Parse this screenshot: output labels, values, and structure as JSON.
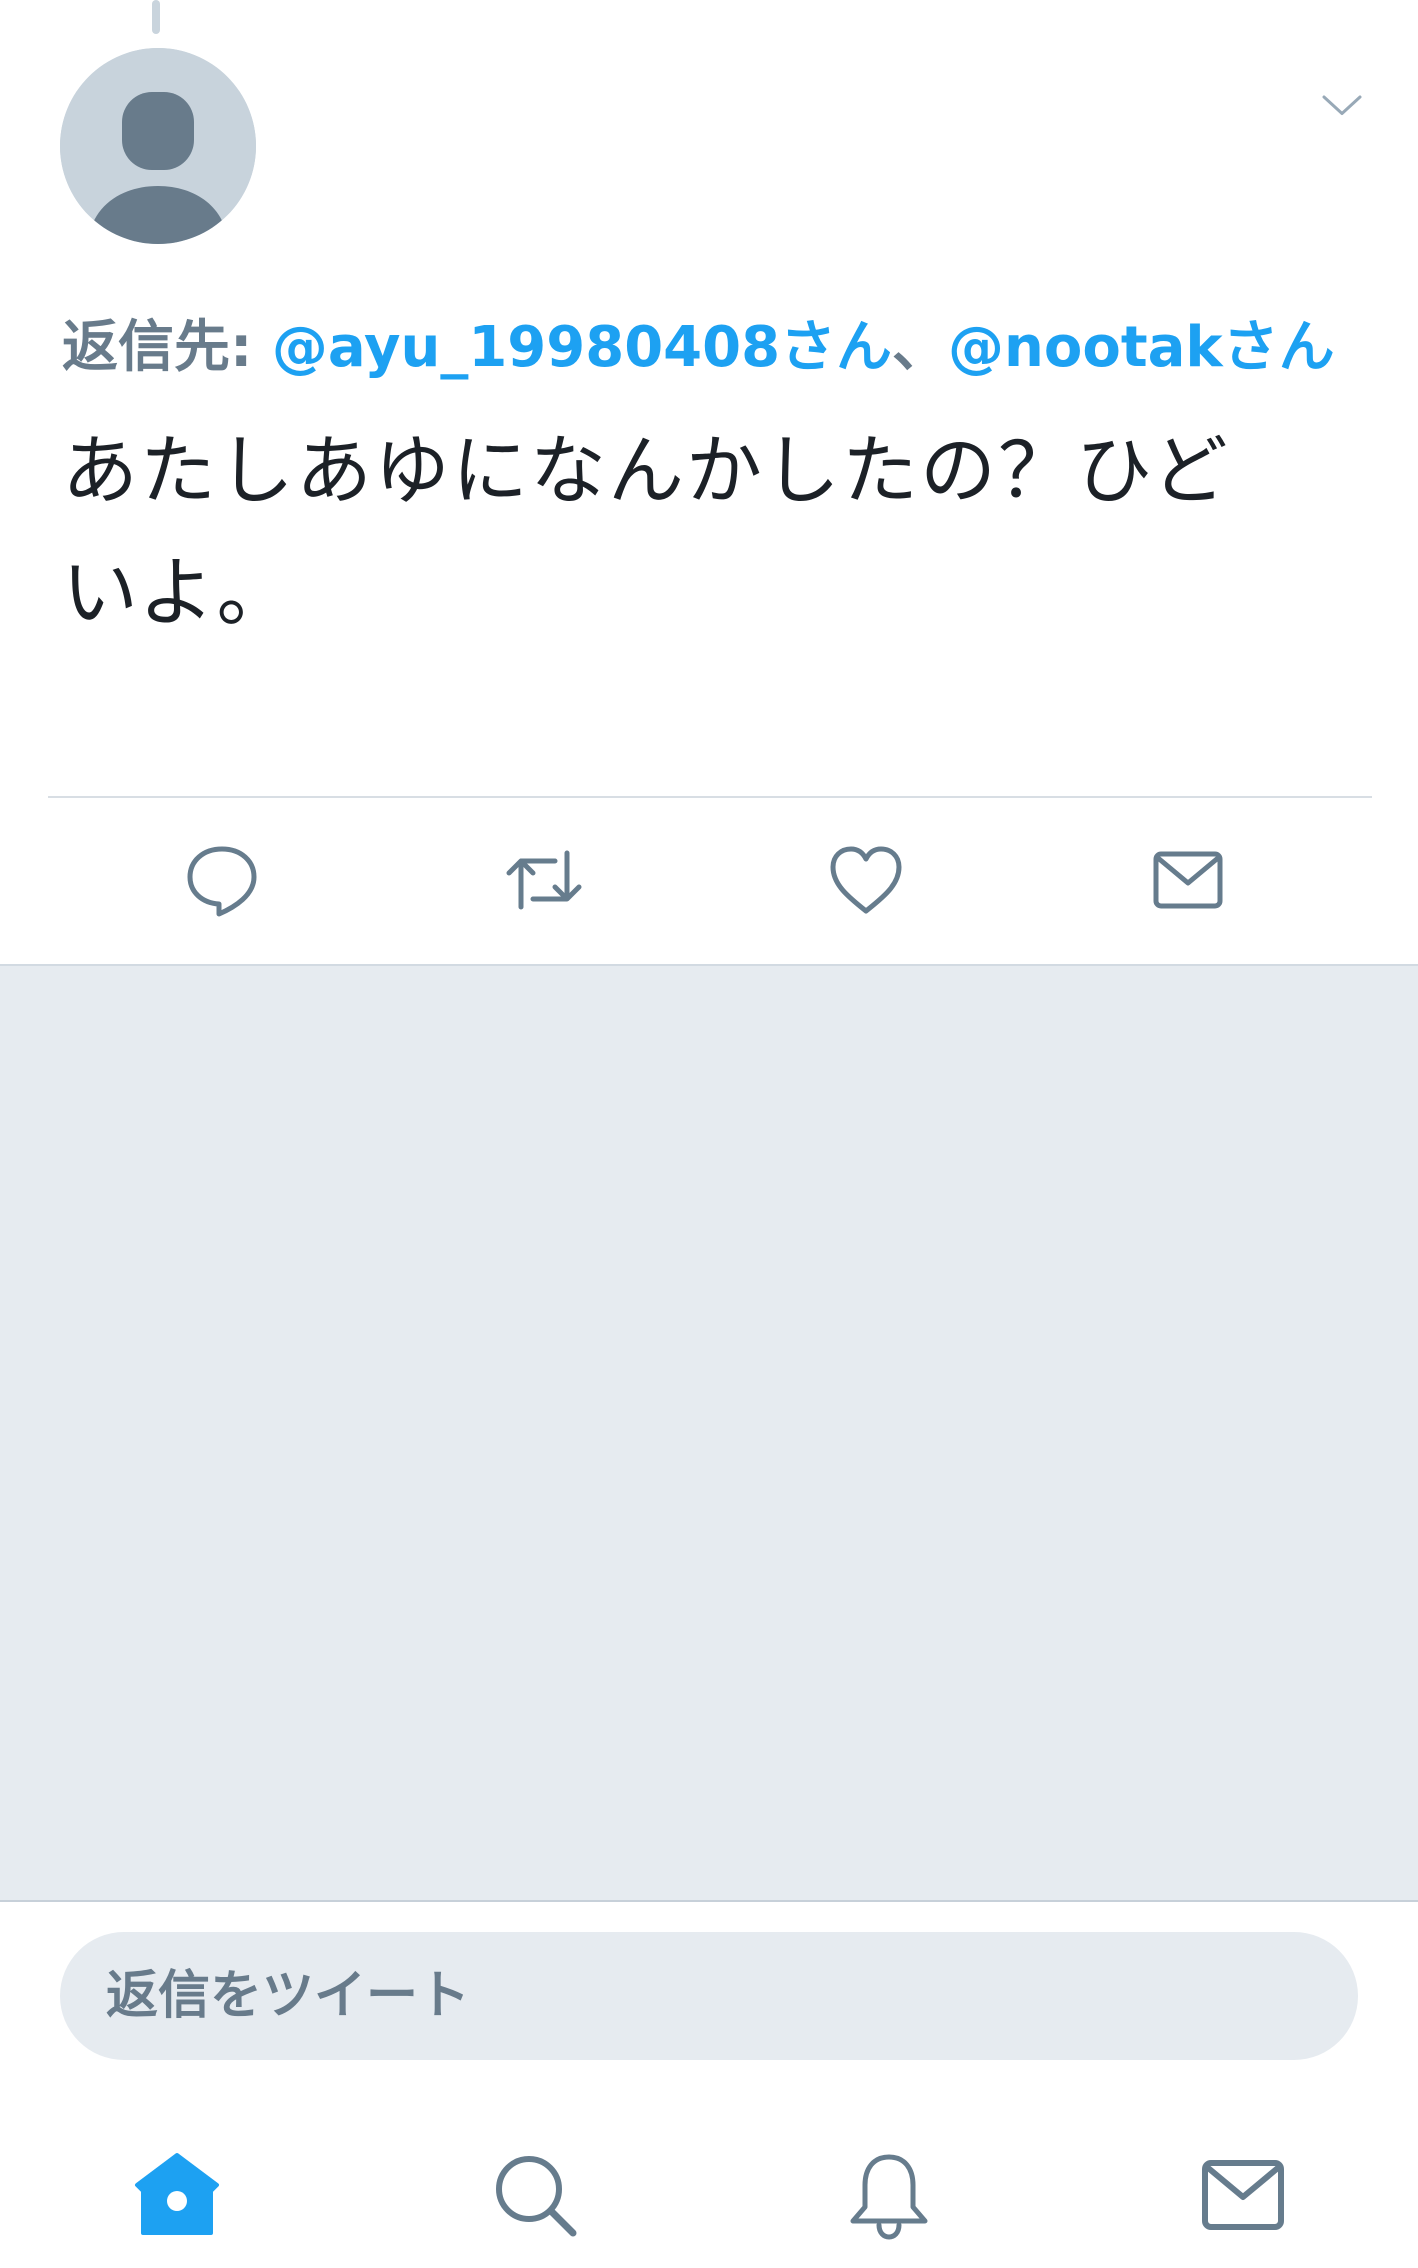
{
  "tweet": {
    "reply_prefix": "返信先: ",
    "mention_1": "@ayu_19980408さん",
    "separator": "、",
    "mention_2": "@nootakさん",
    "text_line_1": "あたしあゆになんかしたの？ひど",
    "text_line_2": "いよ。"
  },
  "actions": {
    "icons": [
      "reply-icon",
      "retweet-icon",
      "like-icon",
      "direct-message-icon"
    ]
  },
  "reply_bar": {
    "placeholder": "返信をツイート"
  },
  "tabbar": {
    "icons": [
      "home-icon",
      "search-icon",
      "notifications-icon",
      "messages-icon"
    ],
    "active": "home",
    "active_color": "#1da1f2",
    "inactive_color": "#667c8d"
  },
  "colors": {
    "mention": "#1da1f2",
    "secondary_text": "#687b8b",
    "background_gray": "#e6ebf0"
  }
}
